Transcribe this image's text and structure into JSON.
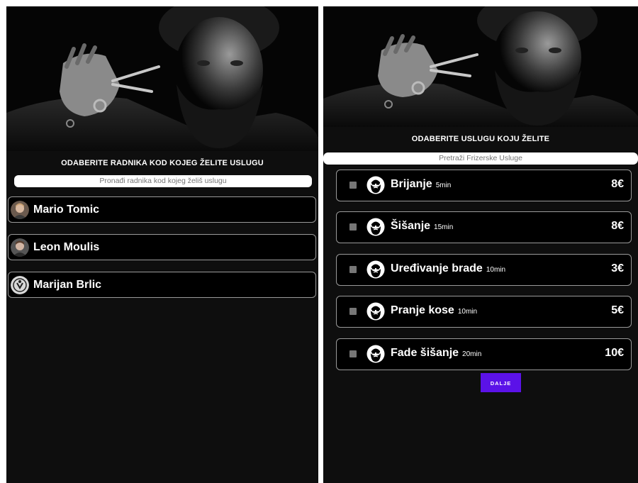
{
  "left_screen": {
    "title": "ODABERITE RADNIKA KOD KOJEG ŽELITE USLUGU",
    "search": {
      "placeholder": "Pronađi radnika kod kojeg želiš uslugu"
    },
    "workers": [
      {
        "name": "Mario Tomic"
      },
      {
        "name": "Leon Moulis"
      },
      {
        "name": "Marijan Brlic"
      }
    ]
  },
  "right_screen": {
    "title": "ODABERITE USLUGU KOJU ŽELITE",
    "search": {
      "placeholder": "Pretraži Frizerske Usluge"
    },
    "services": [
      {
        "name": "Brijanje",
        "duration": "5min",
        "price": "8€",
        "checked": false
      },
      {
        "name": "Šišanje",
        "duration": "15min",
        "price": "8€",
        "checked": false
      },
      {
        "name": "Uređivanje brade",
        "duration": "10min",
        "price": "3€",
        "checked": false
      },
      {
        "name": "Pranje kose",
        "duration": "10min",
        "price": "5€",
        "checked": false
      },
      {
        "name": "Fade šišanje",
        "duration": "20min",
        "price": "10€",
        "checked": false
      }
    ],
    "next_button": "DALJE"
  },
  "colors": {
    "background": "#0e0e0e",
    "accent": "#5b12e8",
    "border": "#9a9a9a",
    "text": "#ffffff"
  },
  "icons": {
    "worker_avatar": "user-avatar-photo",
    "service_icon": "bearded-man-icon",
    "checkbox": "checkbox-unchecked"
  }
}
